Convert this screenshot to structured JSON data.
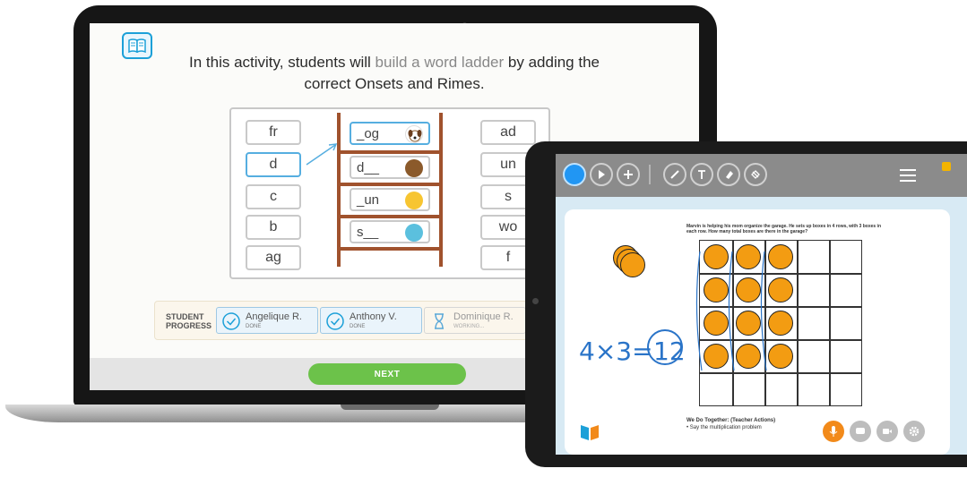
{
  "laptop": {
    "intro_part1": "In this activity, students will ",
    "intro_hl": "build a word ladder",
    "intro_part2": " by adding the ",
    "intro_part3": "correct Onsets and Rimes.",
    "left_tiles": [
      "fr",
      "d",
      "c",
      "b",
      "ag"
    ],
    "ladder_words": [
      "_og",
      "d__",
      "_un",
      "s__"
    ],
    "right_tiles": [
      "ad",
      "un",
      "s",
      "wo",
      "f"
    ],
    "progress_label_1": "STUDENT",
    "progress_label_2": "PROGRESS",
    "students": [
      {
        "name": "Angelique R.",
        "status": "DONE"
      },
      {
        "name": "Anthony V.",
        "status": "DONE"
      },
      {
        "name": "Dominique R.",
        "status": "WORKING..."
      }
    ],
    "next_label": "NEXT"
  },
  "tablet": {
    "problem_text": "Marvin is helping his mom organize the garage. He sets up boxes in 4 rows, with 3 boxes in each row. How many total boxes are there in the garage?",
    "equation_left": "4×3=",
    "equation_answer": "12",
    "we_do_title": "We Do Together: (Teacher Actions)",
    "we_do_item": "•  Say the multiplication problem",
    "tools": [
      "pen-tool",
      "cursor-tool",
      "add-tool",
      "pencil-tool",
      "text-tool",
      "eraser-tool",
      "fill-tool"
    ]
  },
  "colors": {
    "accent_blue": "#1ca0d8",
    "next_green": "#6cc24a",
    "counter_orange": "#f39c12",
    "ladder_brown": "#a0522d",
    "mic_orange": "#f28a1a"
  }
}
